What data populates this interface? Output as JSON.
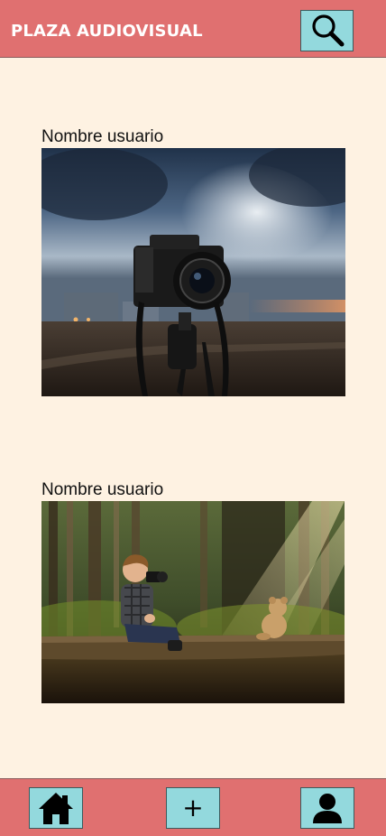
{
  "header": {
    "title": "PLAZA AUDIOVISUAL",
    "search_icon": "search-icon"
  },
  "feed": {
    "posts": [
      {
        "username": "Nombre usuario",
        "image": "camera-on-tripod-stormy-sky-photo"
      },
      {
        "username": "Nombre usuario",
        "image": "child-with-camera-and-teddy-bear-in-forest-photo"
      }
    ]
  },
  "bottom_nav": {
    "home_icon": "home-icon",
    "add_label": "+",
    "profile_icon": "user-icon"
  },
  "colors": {
    "bar": "#e07070",
    "background": "#fef2e2",
    "button": "#93d9dd"
  }
}
